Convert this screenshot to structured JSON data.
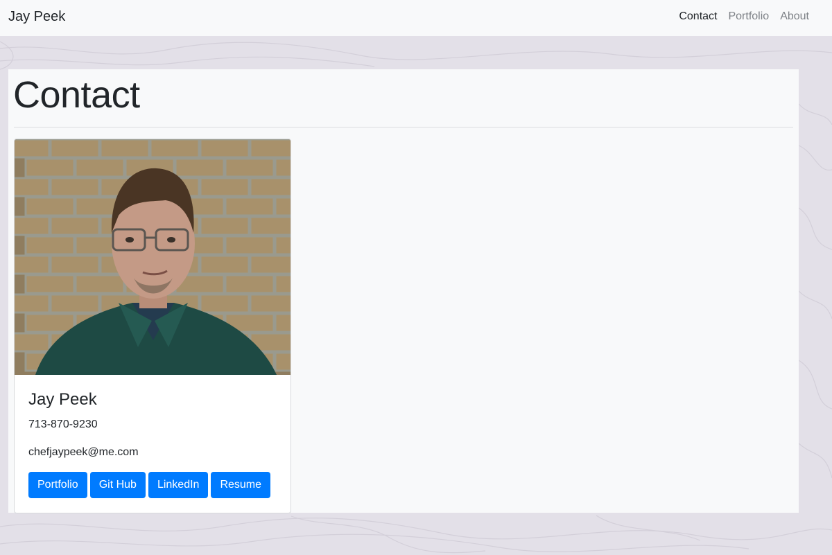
{
  "navbar": {
    "brand": "Jay Peek",
    "links": [
      {
        "label": "Contact",
        "active": true
      },
      {
        "label": "Portfolio",
        "active": false
      },
      {
        "label": "About",
        "active": false
      }
    ]
  },
  "page": {
    "title": "Contact"
  },
  "card": {
    "name": "Jay Peek",
    "phone": "713-870-9230",
    "email": "chefjaypeek@me.com",
    "buttons": [
      "Portfolio",
      "Git Hub",
      "LinkedIn",
      "Resume"
    ]
  },
  "colors": {
    "primary": "#007bff",
    "navbar_bg": "#f8f9fa",
    "page_bg": "#e3e0e8"
  }
}
